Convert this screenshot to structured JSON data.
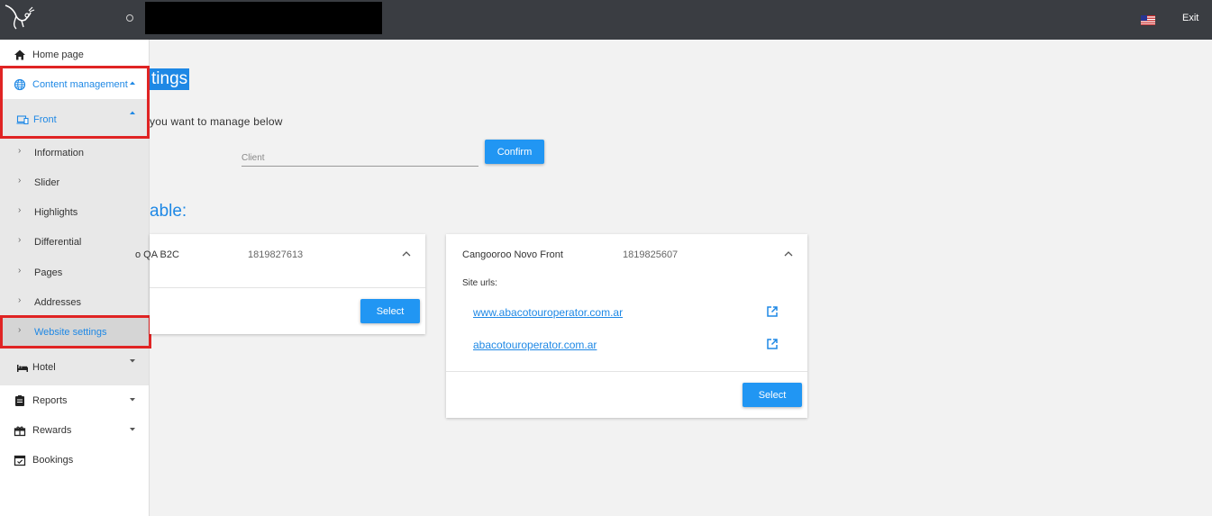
{
  "topbar": {
    "exit_label": "Exit",
    "flag_icon": "us-flag-icon"
  },
  "sidebar": {
    "home": "Home page",
    "content_management": "Content management",
    "front": "Front",
    "sub_items": [
      "Information",
      "Slider",
      "Highlights",
      "Differential",
      "Pages",
      "Addresses",
      "Website settings"
    ],
    "hotel": "Hotel",
    "reports": "Reports",
    "rewards": "Rewards",
    "bookings": "Bookings"
  },
  "main": {
    "title": "tings",
    "instructions": "you want to manage below",
    "client_placeholder": "Client",
    "confirm_label": "Confirm",
    "section_title": "able:"
  },
  "cards": [
    {
      "name": "o QA B2C",
      "code": "1819827613",
      "select_label": "Select",
      "site_urls_label": "",
      "urls": []
    },
    {
      "name": "Cangooroo Novo Front",
      "code": "1819825607",
      "select_label": "Select",
      "site_urls_label": "Site urls:",
      "urls": [
        "www.abacotouroperator.com.ar",
        "abacotouroperator.com.ar"
      ]
    }
  ],
  "colors": {
    "accent": "#1e88e5",
    "button": "#2196f3",
    "topbar": "#3a3d42",
    "highlight_box": "#e02424"
  }
}
